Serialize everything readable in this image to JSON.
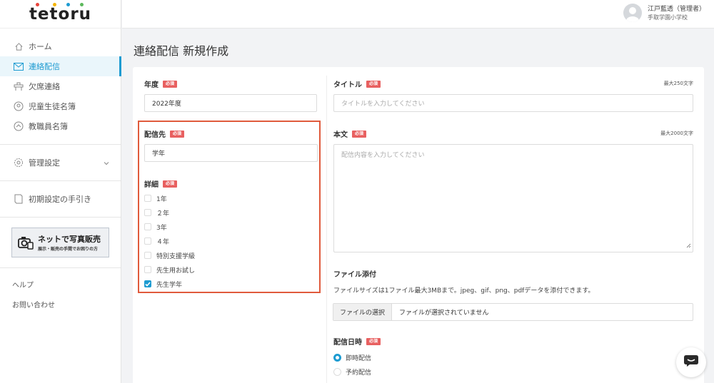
{
  "logo": {
    "text": "tetoru",
    "dot_colors": [
      "#e8453c",
      "#f5b400",
      "#1d9bd1",
      "#5cb85c"
    ]
  },
  "sidebar": {
    "items": [
      {
        "label": "ホーム",
        "icon": "home-icon",
        "active": false
      },
      {
        "label": "連絡配信",
        "icon": "mail-icon",
        "active": true
      },
      {
        "label": "欠席連絡",
        "icon": "absence-icon",
        "active": false
      },
      {
        "label": "児童生徒名簿",
        "icon": "student-list-icon",
        "active": false
      },
      {
        "label": "教職員名簿",
        "icon": "staff-list-icon",
        "active": false
      }
    ],
    "settings": {
      "label": "管理設定",
      "icon": "gear-icon"
    },
    "guide": {
      "label": "初期設定の手引き",
      "icon": "book-icon"
    },
    "promo": {
      "title": "ネットで写真販売",
      "subtitle": "展示・販売の手間でお困りの方"
    },
    "links": [
      "ヘルプ",
      "お問い合わせ"
    ]
  },
  "header": {
    "user_name": "江戸藍透（管理者）",
    "school": "手取学園小学校"
  },
  "page": {
    "title": "連絡配信 新規作成"
  },
  "form": {
    "required_label": "必須",
    "year": {
      "label": "年度",
      "value": "2022年度"
    },
    "destination": {
      "label": "配信先",
      "value": "学年"
    },
    "details": {
      "label": "詳細",
      "options": [
        {
          "label": "1年",
          "checked": false
        },
        {
          "label": "２年",
          "checked": false
        },
        {
          "label": "3年",
          "checked": false
        },
        {
          "label": "４年",
          "checked": false
        },
        {
          "label": "特別支援学級",
          "checked": false
        },
        {
          "label": "先生用お試し",
          "checked": false
        },
        {
          "label": "先生学年",
          "checked": true
        }
      ]
    },
    "title": {
      "label": "タイトル",
      "maxlen": "最大250文字",
      "placeholder": "タイトルを入力してください"
    },
    "body": {
      "label": "本文",
      "maxlen": "最大2000文字",
      "placeholder": "配信内容を入力してください"
    },
    "attachment": {
      "label": "ファイル添付",
      "note": "ファイルサイズは1ファイル最大3MBまで。jpeg、gif、png、pdfデータを添付できます。",
      "button": "ファイルの選択",
      "status": "ファイルが選択されていません"
    },
    "schedule": {
      "label": "配信日時",
      "options": [
        {
          "label": "即時配信",
          "selected": true
        },
        {
          "label": "予約配信",
          "selected": false
        }
      ]
    }
  },
  "colors": {
    "accent": "#1d9bd1",
    "required": "#e86060",
    "highlight": "#e05a3c"
  }
}
